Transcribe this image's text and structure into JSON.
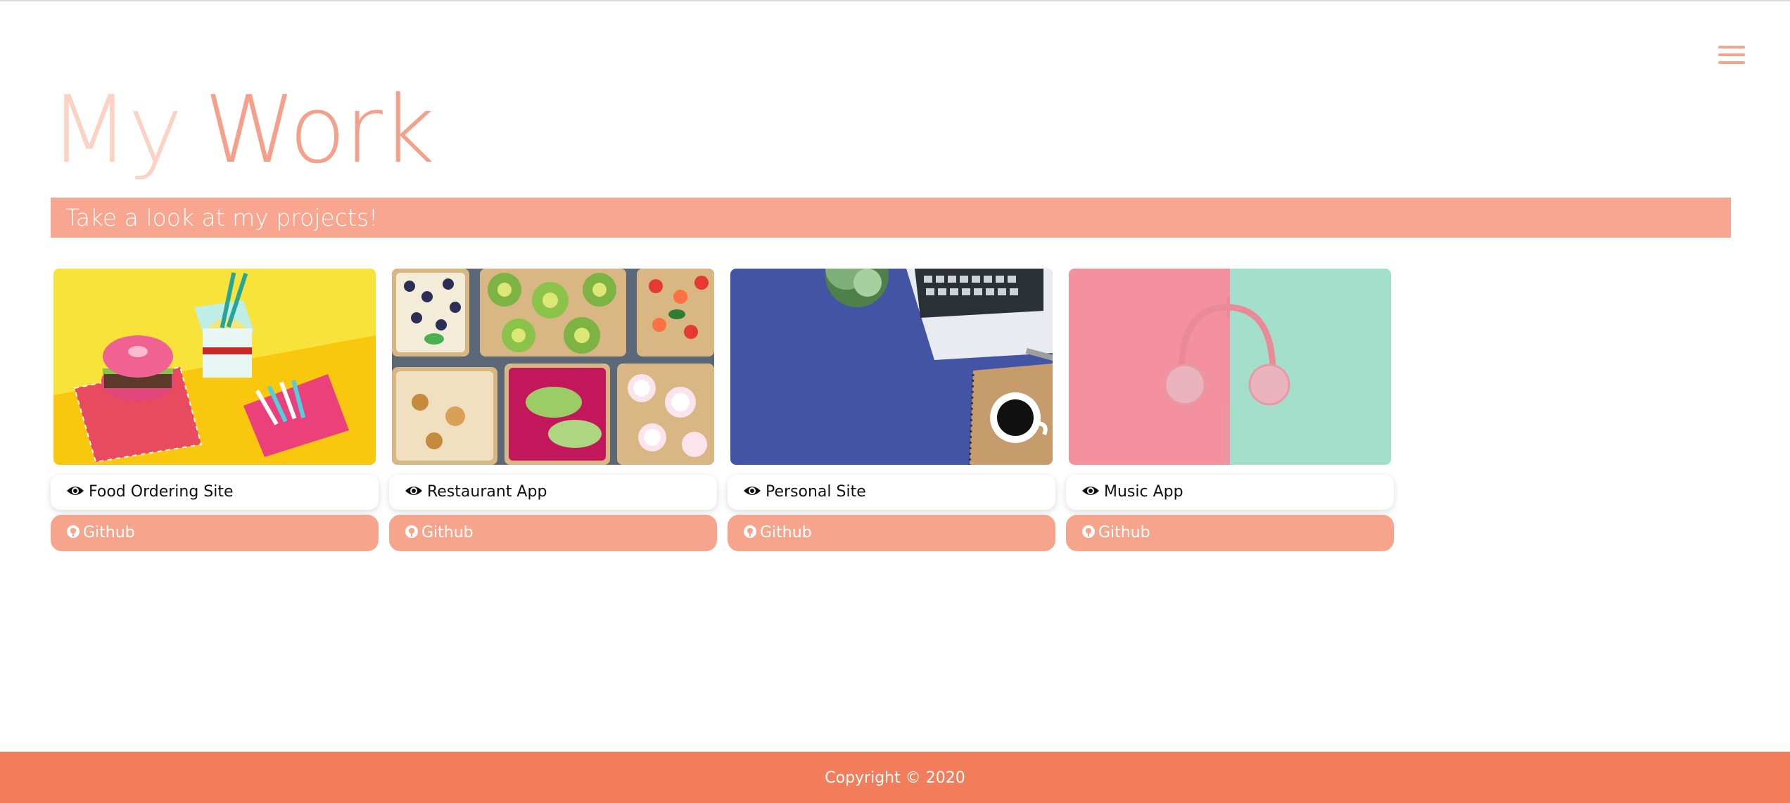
{
  "header": {
    "menu_icon": "hamburger-menu-icon",
    "title_first": "My",
    "title_second": "Work",
    "subtitle": "Take a look at my projects!"
  },
  "projects": [
    {
      "label": "Food Ordering Site",
      "github_label": "Github",
      "view_icon": "eye-icon",
      "github_icon": "github-icon"
    },
    {
      "label": "Restaurant App",
      "github_label": "Github",
      "view_icon": "eye-icon",
      "github_icon": "github-icon"
    },
    {
      "label": "Personal Site",
      "github_label": "Github",
      "view_icon": "eye-icon",
      "github_icon": "github-icon"
    },
    {
      "label": "Music App",
      "github_label": "Github",
      "view_icon": "eye-icon",
      "github_icon": "github-icon"
    }
  ],
  "footer": {
    "copyright": "Copyright © 2020"
  },
  "colors": {
    "accent": "#f6a48b",
    "title_light": "#fbd2c4",
    "title_dark": "#f4a08a",
    "footer": "#f27d5a"
  }
}
